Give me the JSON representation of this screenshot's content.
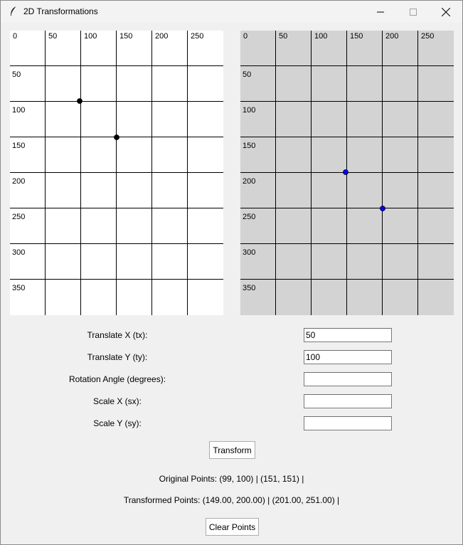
{
  "window": {
    "title": "2D Transformations",
    "icon": "feather-icon",
    "controls": [
      "minimize-icon",
      "maximize-icon",
      "close-icon"
    ]
  },
  "canvas_original": {
    "background": "#ffffff",
    "point_color": "#000000",
    "x_labels": [
      "0",
      "50",
      "100",
      "150",
      "200",
      "250"
    ],
    "y_labels": [
      "50",
      "100",
      "150",
      "200",
      "250",
      "300",
      "350"
    ],
    "points": [
      [
        99,
        100
      ],
      [
        151,
        151
      ]
    ]
  },
  "canvas_transformed": {
    "background": "#d3d3d3",
    "point_color": "#0000ff",
    "x_labels": [
      "0",
      "50",
      "100",
      "150",
      "200",
      "250"
    ],
    "y_labels": [
      "50",
      "100",
      "150",
      "200",
      "250",
      "300",
      "350"
    ],
    "points": [
      [
        149,
        200
      ],
      [
        201,
        251
      ]
    ]
  },
  "form": {
    "tx_label": "Translate X (tx):",
    "tx_value": "50",
    "ty_label": "Translate Y (ty):",
    "ty_value": "100",
    "rotation_label": "Rotation Angle (degrees):",
    "rotation_value": "",
    "sx_label": "Scale X (sx):",
    "sx_value": "",
    "sy_label": "Scale Y (sy):",
    "sy_value": ""
  },
  "buttons": {
    "transform": "Transform",
    "clear": "Clear Points"
  },
  "results": {
    "original": "Original Points: (99, 100)  |  (151, 151)  |",
    "transformed": "Transformed Points: (149.00, 200.00)  |  (201.00, 251.00)  |"
  }
}
